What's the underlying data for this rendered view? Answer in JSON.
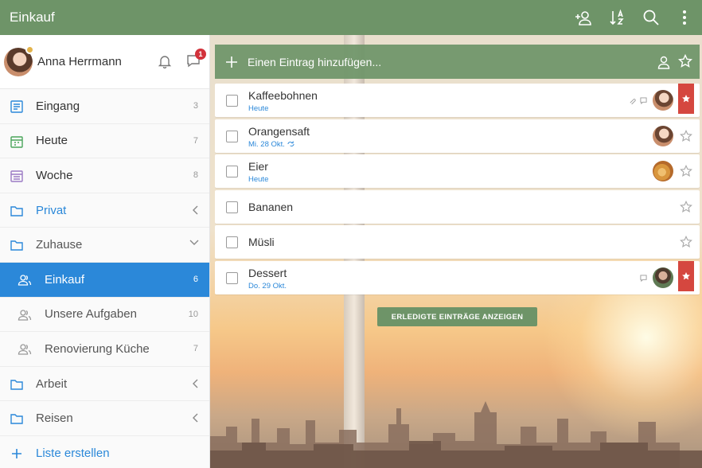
{
  "topbar": {
    "title": "Einkauf",
    "icons": [
      "share-person-icon",
      "sort-az-icon",
      "search-icon",
      "more-vertical-icon"
    ]
  },
  "profile": {
    "name": "Anna Herrmann",
    "notification_badge": "1"
  },
  "sidebar": {
    "items": [
      {
        "label": "Eingang",
        "count": "3",
        "icon": "inbox-icon"
      },
      {
        "label": "Heute",
        "count": "7",
        "icon": "calendar-today-icon"
      },
      {
        "label": "Woche",
        "count": "8",
        "icon": "calendar-week-icon"
      },
      {
        "label": "Privat",
        "icon": "folder-icon"
      },
      {
        "label": "Zuhause",
        "icon": "folder-icon"
      },
      {
        "label": "Einkauf",
        "count": "6",
        "icon": "shared-list-icon"
      },
      {
        "label": "Unsere Aufgaben",
        "count": "10",
        "icon": "shared-list-icon"
      },
      {
        "label": "Renovierung Küche",
        "count": "7",
        "icon": "shared-list-icon"
      },
      {
        "label": "Arbeit",
        "icon": "folder-icon"
      },
      {
        "label": "Reisen",
        "icon": "folder-icon"
      }
    ],
    "create_list_label": "Liste erstellen"
  },
  "addbar": {
    "placeholder": "Einen Eintrag hinzufügen..."
  },
  "tasks": [
    {
      "title": "Kaffeebohnen",
      "due": "Heute",
      "starred": true
    },
    {
      "title": "Orangensaft",
      "due": "Mi. 28 Okt.",
      "starred": false
    },
    {
      "title": "Eier",
      "due": "Heute",
      "starred": false
    },
    {
      "title": "Bananen",
      "due": "",
      "starred": false
    },
    {
      "title": "Müsli",
      "due": "",
      "starred": false
    },
    {
      "title": "Dessert",
      "due": "Do. 29 Okt.",
      "starred": true
    }
  ],
  "show_completed_label": "ERLEDIGTE EINTRÄGE ANZEIGEN",
  "colors": {
    "accent_green": "#6e9468",
    "accent_blue": "#2b88d9",
    "star_red": "#d5473f"
  }
}
